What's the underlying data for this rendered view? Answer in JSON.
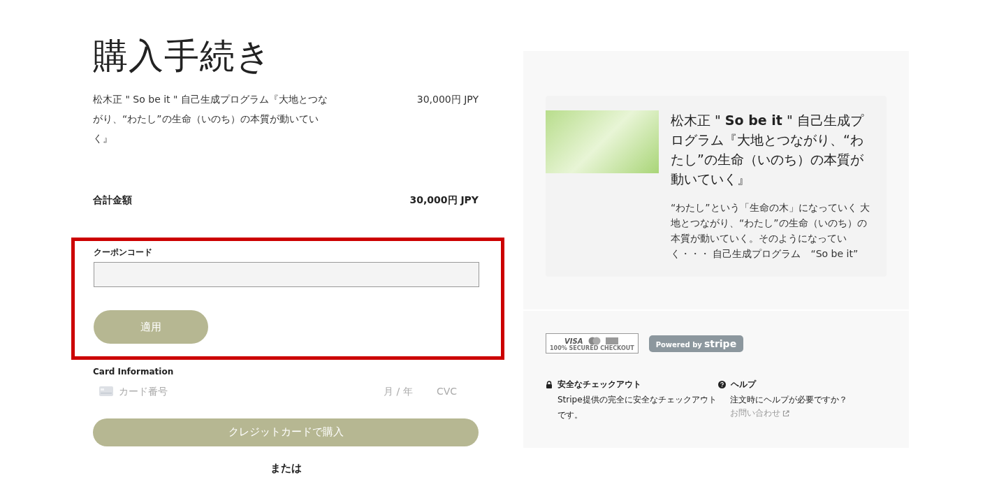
{
  "title": "購入手続き",
  "line_item": {
    "name": "松木正 \" So be it \" 自己生成プログラム『大地とつながり、“わたし”の生命（いのち）の本質が動いていく』",
    "price": "30,000円 JPY"
  },
  "total": {
    "label": "合計金額",
    "amount": "30,000円 JPY"
  },
  "coupon": {
    "label": "クーポンコード",
    "apply_button": "適用"
  },
  "card": {
    "label": "Card Information",
    "number_placeholder": "カード番号",
    "expiry_placeholder": "月 / 年",
    "cvc_placeholder": "CVC"
  },
  "pay_button": "クレジットカードで購入",
  "or_text": "または",
  "product": {
    "title": "松木正 \" **So be it** \" 自己生成プログラム『大地とつながり、“わたし”の生命（いのち）の本質が動いていく』",
    "description": "“わたし”という「生命の木」になっていく 大地とつながり、“わたし”の生命（いのち）の本質が動いていく。そのようになっていく・・・ 自己生成プログラム　“So be it”"
  },
  "badges": {
    "cards_brand": "VISA",
    "cards_caption": "100% SECURED CHECKOUT",
    "powered_by": "Powered by",
    "stripe": "stripe"
  },
  "info": [
    {
      "kind": "lock",
      "title": "安全なチェックアウト",
      "text": "Stripe提供の完全に安全なチェックアウトです。"
    },
    {
      "kind": "help",
      "title": "ヘルプ",
      "text": "注文時にヘルプが必要ですか？",
      "link": "お問い合わせ"
    }
  ]
}
